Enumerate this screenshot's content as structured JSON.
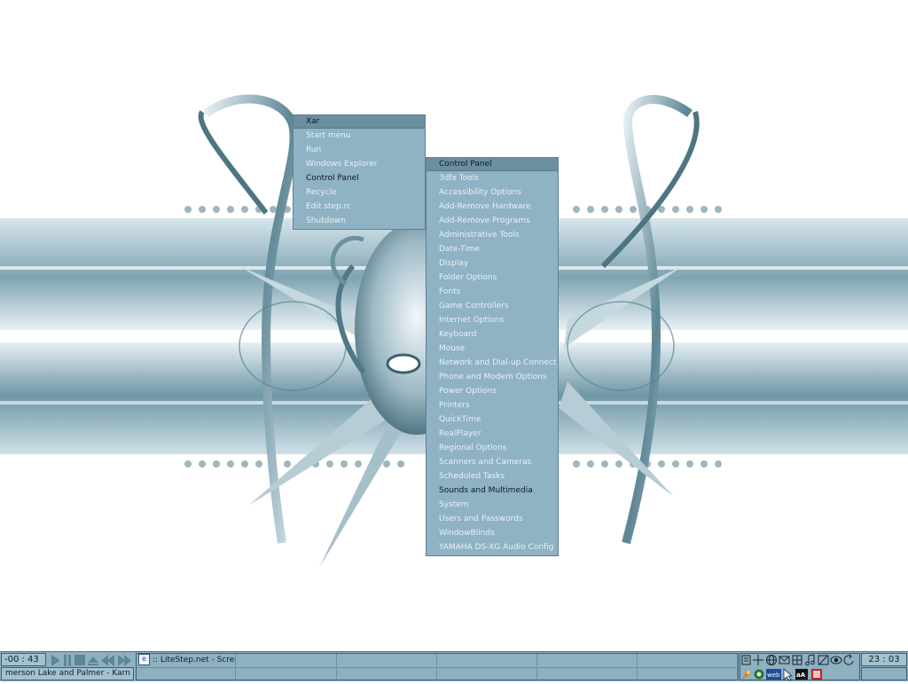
{
  "xar_menu": {
    "title": "Xar",
    "items": [
      {
        "label": "Start menu"
      },
      {
        "label": "Run"
      },
      {
        "label": "Windows Explorer"
      },
      {
        "label": "Control Panel"
      },
      {
        "label": "Recycle"
      },
      {
        "label": "Edit step.rc"
      },
      {
        "label": "Shutdown"
      }
    ],
    "active_index": 3
  },
  "control_panel_menu": {
    "title": "Control Panel",
    "items": [
      {
        "label": "3dfx Tools"
      },
      {
        "label": "Accessibility Options"
      },
      {
        "label": "Add-Remove Hardware"
      },
      {
        "label": "Add-Remove Programs"
      },
      {
        "label": "Administrative Tools"
      },
      {
        "label": "Date-Time"
      },
      {
        "label": "Display"
      },
      {
        "label": "Folder Options"
      },
      {
        "label": "Fonts"
      },
      {
        "label": "Game Controllers"
      },
      {
        "label": "Internet Options"
      },
      {
        "label": "Keyboard"
      },
      {
        "label": "Mouse"
      },
      {
        "label": "Network and Dial-up Connect..."
      },
      {
        "label": "Phone and Modem Options"
      },
      {
        "label": "Power Options"
      },
      {
        "label": "Printers"
      },
      {
        "label": "QuickTime"
      },
      {
        "label": "RealPlayer"
      },
      {
        "label": "Regional Options"
      },
      {
        "label": "Scanners and Cameras"
      },
      {
        "label": "Scheduled Tasks"
      },
      {
        "label": "Sounds and Multimedia"
      },
      {
        "label": "System"
      },
      {
        "label": "Users and Passwords"
      },
      {
        "label": "WindowBlinds"
      },
      {
        "label": "YAMAHA DS-XG Audio Config"
      }
    ],
    "active_index": 22
  },
  "taskbar": {
    "player_time": "-00 : 43",
    "player_track": "merson Lake and Palmer - Karn Ev",
    "task_1_title": ":: LiteStep.net - Screer",
    "clock": "23 : 03",
    "tray_icons": [
      "list-icon",
      "cross-icon",
      "globe-icon",
      "mail-icon",
      "network-icon",
      "music-icon",
      "pen-icon",
      "eye-icon",
      "refresh-icon",
      "rocket-icon",
      "recycle-icon",
      "web-badge-icon",
      "pointer-icon",
      "font-icon",
      "media-icon"
    ]
  },
  "colors": {
    "menu_bg": "#8fb2c4",
    "menu_title_bg": "#6c8f9f",
    "taskbar_bg": "#8eb0c1"
  }
}
